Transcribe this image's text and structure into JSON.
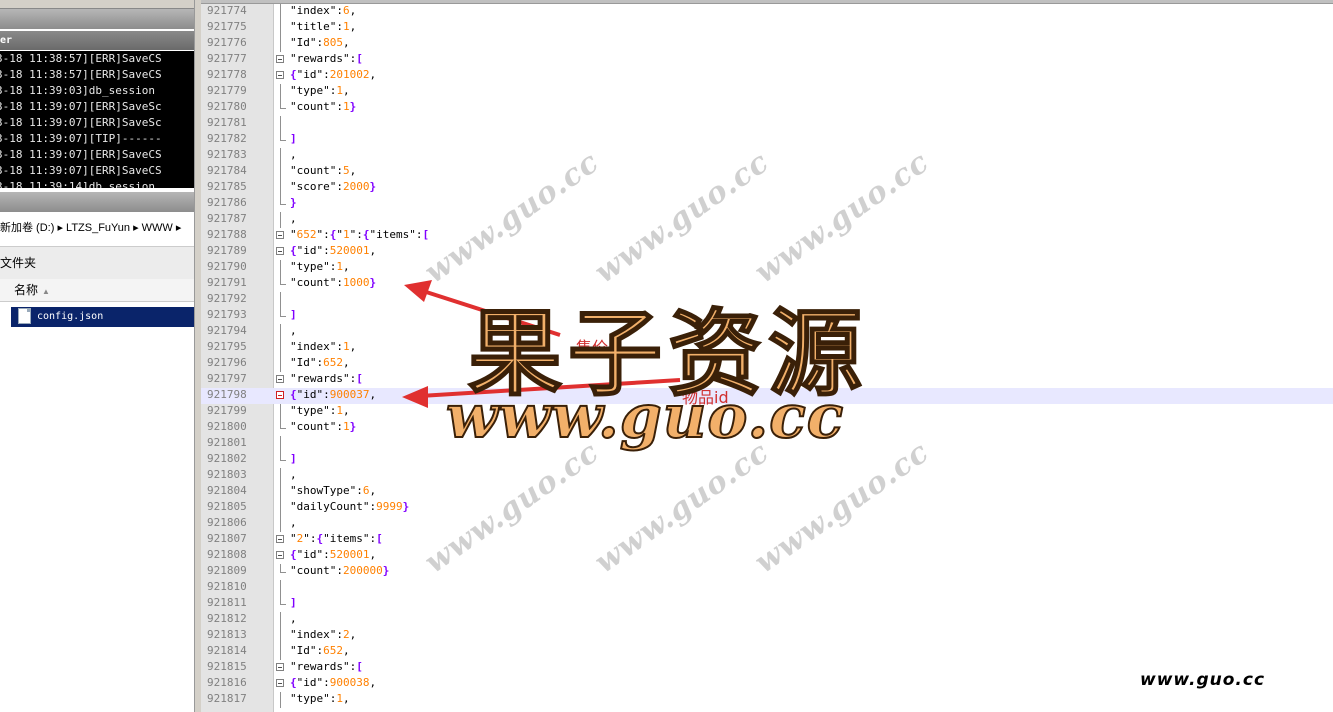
{
  "left_pane": {
    "console_title": "er",
    "console_lines": [
      "3-18 11:38:57][ERR]SaveCS",
      "3-18 11:38:57][ERR]SaveCS",
      "3-18 11:39:03]db_session",
      "3-18 11:39:07][ERR]SaveSc",
      "3-18 11:39:07][ERR]SaveSc",
      "3-18 11:39:07][TIP]------",
      "3-18 11:39:07][ERR]SaveCS",
      "3-18 11:39:07][ERR]SaveCS",
      "3-18 11:39:14]db_session"
    ],
    "address_bar": "新加卷 (D:) ▸ LTZS_FuYun ▸ WWW ▸",
    "new_folder_label": "文件夹",
    "column_name": "名称",
    "selected_file": "config.json"
  },
  "editor": {
    "lines": [
      {
        "n": "921774",
        "code": "\"index\":6,"
      },
      {
        "n": "921775",
        "code": "\"title\":1,"
      },
      {
        "n": "921776",
        "code": "\"Id\":805,"
      },
      {
        "n": "921777",
        "code": "\"rewards\":["
      },
      {
        "n": "921778",
        "code": "{\"id\":201002,"
      },
      {
        "n": "921779",
        "code": "\"type\":1,"
      },
      {
        "n": "921780",
        "code": "\"count\":1}"
      },
      {
        "n": "921781",
        "code": ""
      },
      {
        "n": "921782",
        "code": "]"
      },
      {
        "n": "921783",
        "code": ","
      },
      {
        "n": "921784",
        "code": "\"count\":5,"
      },
      {
        "n": "921785",
        "code": "\"score\":2000}"
      },
      {
        "n": "921786",
        "code": "}"
      },
      {
        "n": "921787",
        "code": ","
      },
      {
        "n": "921788",
        "code": "\"652\":{\"1\":{\"items\":["
      },
      {
        "n": "921789",
        "code": "{\"id\":520001,"
      },
      {
        "n": "921790",
        "code": "\"type\":1,"
      },
      {
        "n": "921791",
        "code": "\"count\":1000}"
      },
      {
        "n": "921792",
        "code": ""
      },
      {
        "n": "921793",
        "code": "]"
      },
      {
        "n": "921794",
        "code": ","
      },
      {
        "n": "921795",
        "code": "\"index\":1,"
      },
      {
        "n": "921796",
        "code": "\"Id\":652,"
      },
      {
        "n": "921797",
        "code": "\"rewards\":["
      },
      {
        "n": "921798",
        "code": "{\"id\":900037,"
      },
      {
        "n": "921799",
        "code": "\"type\":1,"
      },
      {
        "n": "921800",
        "code": "\"count\":1}"
      },
      {
        "n": "921801",
        "code": ""
      },
      {
        "n": "921802",
        "code": "]"
      },
      {
        "n": "921803",
        "code": ","
      },
      {
        "n": "921804",
        "code": "\"showType\":6,"
      },
      {
        "n": "921805",
        "code": "\"dailyCount\":9999}"
      },
      {
        "n": "921806",
        "code": ","
      },
      {
        "n": "921807",
        "code": "\"2\":{\"items\":["
      },
      {
        "n": "921808",
        "code": "{\"id\":520001,"
      },
      {
        "n": "921809",
        "code": "\"count\":200000}"
      },
      {
        "n": "921810",
        "code": ""
      },
      {
        "n": "921811",
        "code": "]"
      },
      {
        "n": "921812",
        "code": ","
      },
      {
        "n": "921813",
        "code": "\"index\":2,"
      },
      {
        "n": "921814",
        "code": "\"Id\":652,"
      },
      {
        "n": "921815",
        "code": "\"rewards\":["
      },
      {
        "n": "921816",
        "code": "{\"id\":900038,"
      },
      {
        "n": "921817",
        "code": "\"type\":1,"
      }
    ],
    "highlighted_line": "921798"
  },
  "annotations": {
    "price_label": "售价",
    "item_id_label": "物品id",
    "arrow_color": "#e03030"
  },
  "watermark": {
    "brand_cn": "果子资源",
    "brand_url": "www.guo.cc",
    "tile_text": "www.guo.cc",
    "corner_text": "www.guo.cc"
  }
}
